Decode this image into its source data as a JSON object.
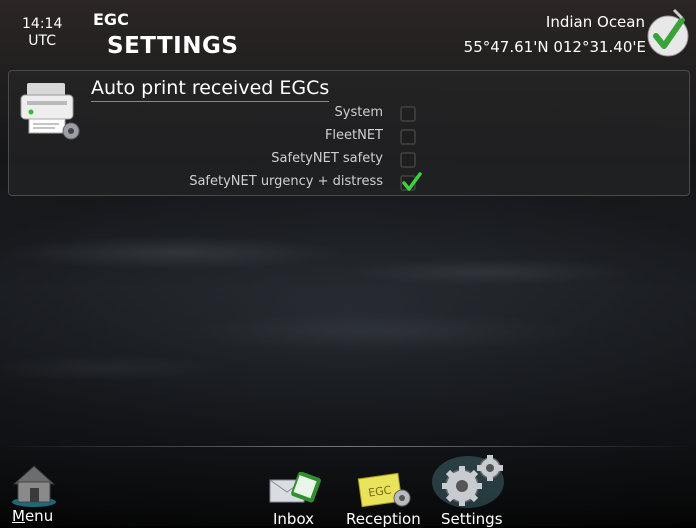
{
  "header": {
    "time": "14:14",
    "timezone": "UTC",
    "app_name": "EGC",
    "page_title": "SETTINGS",
    "region": "Indian Ocean",
    "coordinates": "55°47.61'N  012°31.40'E"
  },
  "panel": {
    "title": "Auto print received EGCs",
    "options": [
      {
        "label": "System",
        "checked": false
      },
      {
        "label": "FleetNET",
        "checked": false
      },
      {
        "label": "SafetyNET safety",
        "checked": false
      },
      {
        "label": "SafetyNET urgency + distress",
        "checked": true
      }
    ]
  },
  "bottom_bar": {
    "menu_label": "Menu",
    "tabs": [
      {
        "label": "Inbox",
        "icon": "inbox-icon"
      },
      {
        "label": "Reception",
        "icon": "reception-icon"
      },
      {
        "label": "Settings",
        "icon": "settings-gears-icon",
        "active": true
      }
    ]
  },
  "colors": {
    "accent_green": "#39d23a",
    "text": "#ffffff",
    "option_text": "#d0d0d0"
  }
}
